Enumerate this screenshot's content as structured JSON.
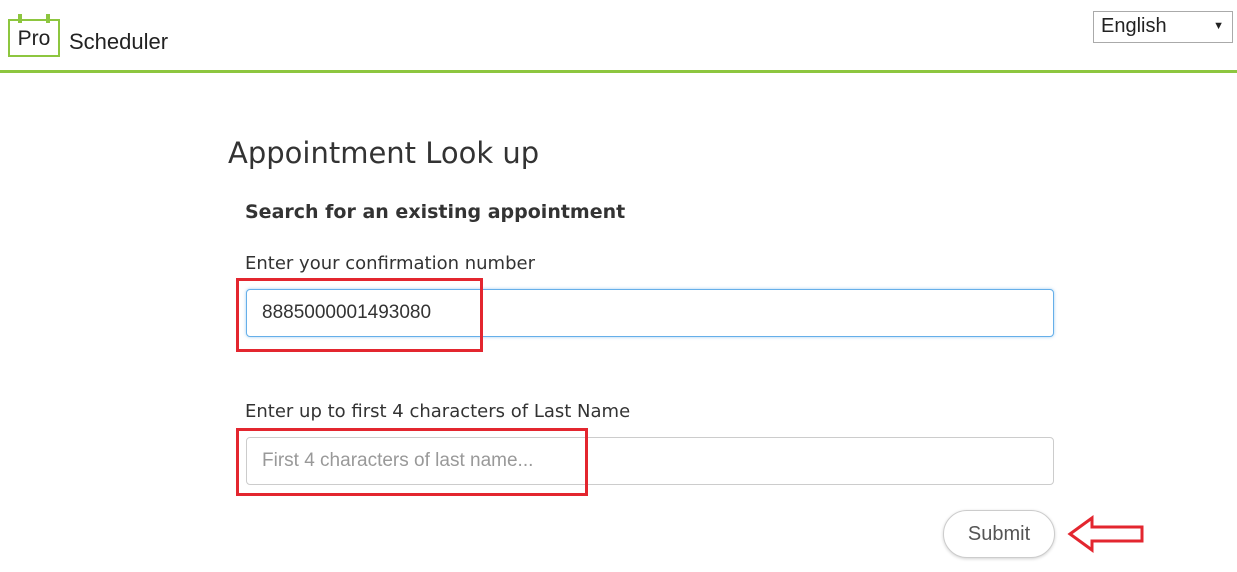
{
  "header": {
    "logo_badge": "Pro",
    "logo_text": "Scheduler",
    "language": {
      "selected": "English",
      "options": [
        "English"
      ]
    }
  },
  "main": {
    "title": "Appointment Look up",
    "subtitle": "Search for an existing appointment",
    "confirmation": {
      "label": "Enter your confirmation number",
      "value": "8885000001493080"
    },
    "last_name": {
      "label": "Enter up to first 4 characters of Last Name",
      "value": "",
      "placeholder": "First 4 characters of last name..."
    },
    "submit_label": "Submit"
  },
  "colors": {
    "brand_green": "#8dc63f",
    "annotation_red": "#e3262f",
    "focus_blue": "#66afe9"
  },
  "icons": {
    "calendar_logo": "calendar-logo-icon",
    "dropdown_caret": "caret-down-icon",
    "annotation_arrow": "arrow-left-outline-icon"
  }
}
